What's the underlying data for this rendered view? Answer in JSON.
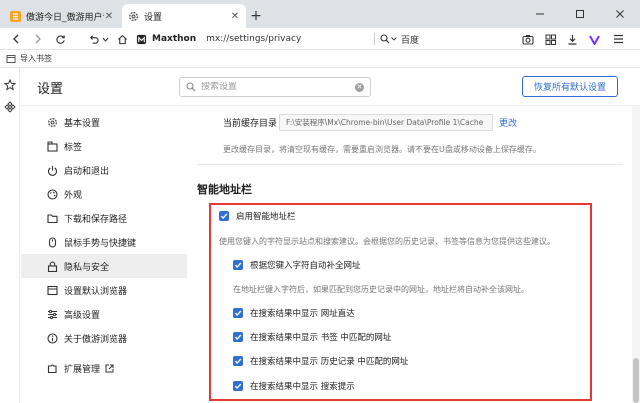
{
  "tabs": [
    {
      "title": "傲游今日_傲游用户专属",
      "active": false
    },
    {
      "title": "设置",
      "active": true
    }
  ],
  "toolbar": {
    "brand": "Maxthon",
    "url": "mx://settings/privacy",
    "search_engine": "百度"
  },
  "bookmark_bar": {
    "import_label": "导入书签"
  },
  "page": {
    "title": "设置",
    "search_placeholder": "搜索设置",
    "reset_button": "恢复所有默认设置"
  },
  "nav_items": [
    {
      "label": "基本设置",
      "icon": "gear-icon"
    },
    {
      "label": "标签",
      "icon": "tab-icon"
    },
    {
      "label": "启动和退出",
      "icon": "power-icon"
    },
    {
      "label": "外观",
      "icon": "palette-icon"
    },
    {
      "label": "下载和保存路径",
      "icon": "folder-icon"
    },
    {
      "label": "鼠标手势与快捷键",
      "icon": "mouse-icon"
    },
    {
      "label": "隐私与安全",
      "icon": "lock-icon",
      "active": true
    },
    {
      "label": "设置默认浏览器",
      "icon": "browser-icon"
    },
    {
      "label": "高级设置",
      "icon": "sliders-icon"
    },
    {
      "label": "关于傲游浏览器",
      "icon": "info-icon"
    }
  ],
  "nav_extensions": "扩展管理",
  "cache": {
    "label": "当前缓存目录",
    "path": "F:\\安装程序\\Mx\\Chrome-bin\\User Data\\Profile 1\\Cache",
    "change": "更改",
    "note": "更改缓存目录，将清空现有缓存，需要重启浏览器。请不要在U盘或移动设备上保存缓存。"
  },
  "smart_bar": {
    "title": "智能地址栏",
    "enable_label": "启用智能地址栏",
    "enable_desc": "使用您键入的字符显示站点和搜索建议。会根据您的历史记录、书签等信息为您提供这些建议。",
    "autocomplete_label": "根据您键入字符自动补全网址",
    "autocomplete_desc": "在地址栏键入字符后，如果匹配到您历史记录中的网址，地址栏将自动补全该网址。",
    "options": [
      "在搜索结果中显示 网址直达",
      "在搜索结果中显示 书签 中匹配的网址",
      "在搜索结果中显示 历史记录 中匹配的网址",
      "在搜索结果中显示 搜索提示"
    ]
  },
  "colors": {
    "accent": "#2f6fd1",
    "highlight_box": "#e53935"
  }
}
